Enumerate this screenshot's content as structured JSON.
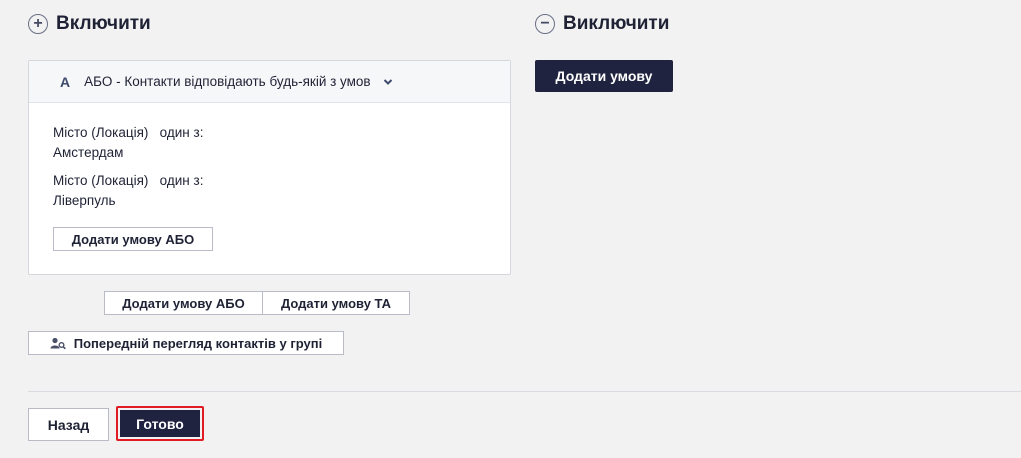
{
  "include": {
    "title": "Включити",
    "icon": "plus-circle-icon"
  },
  "exclude": {
    "title": "Виключити",
    "icon": "minus-circle-icon",
    "add_condition_label": "Додати умову"
  },
  "group": {
    "letter": "A",
    "title": "АБО - Контакти відповідають будь-якій з умов",
    "conditions": [
      {
        "field": "Місто (Локація)",
        "operator": "один з:",
        "value": "Амстердам"
      },
      {
        "field": "Місто (Локація)",
        "operator": "один з:",
        "value": "Ліверпуль"
      }
    ],
    "add_or_label": "Додати умову АБО"
  },
  "actions": {
    "add_or_label": "Додати умову АБО",
    "add_and_label": "Додати умову ТА",
    "preview_label": "Попередній перегляд контактів у групі"
  },
  "footer": {
    "back_label": "Назад",
    "done_label": "Готово"
  },
  "colors": {
    "primary_dark": "#1f2340",
    "highlight_red": "#e01b24"
  }
}
